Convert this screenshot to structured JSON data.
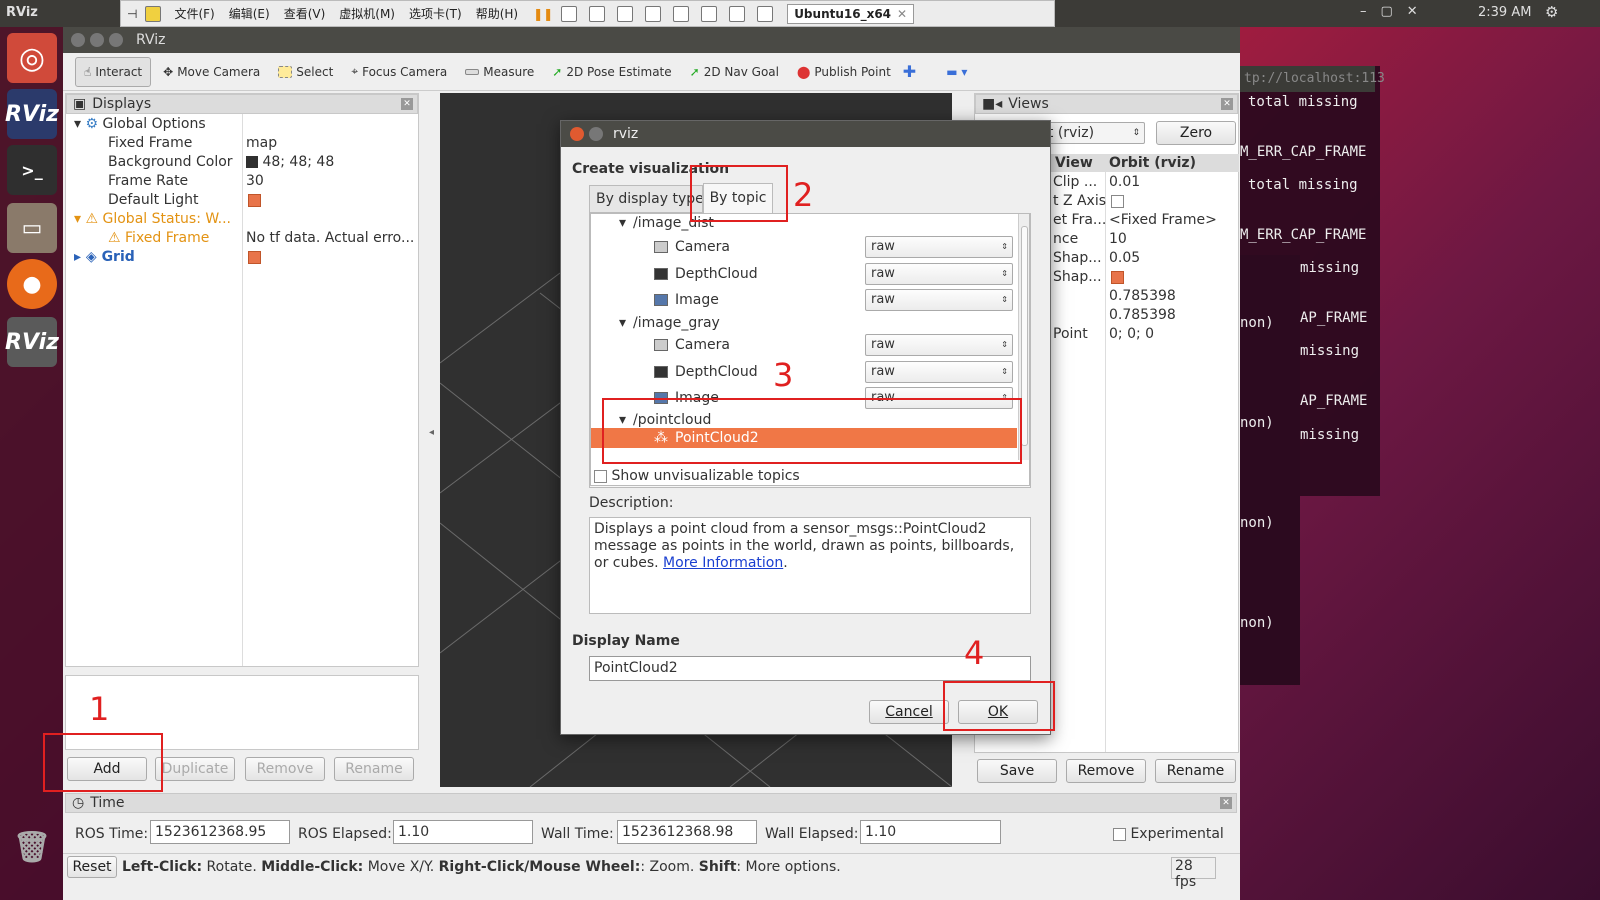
{
  "topbar": {
    "app": "RViz",
    "time": "2:39 AM"
  },
  "vmware": {
    "menus": [
      "文件(F)",
      "编辑(E)",
      "查看(V)",
      "虚拟机(M)",
      "选项卡(T)",
      "帮助(H)"
    ],
    "tab": "Ubuntu16_x64"
  },
  "launcher": {
    "items": [
      "RViz",
      "RViz"
    ]
  },
  "rviz": {
    "title": "RViz",
    "tools": [
      "Interact",
      "Move Camera",
      "Select",
      "Focus Camera",
      "Measure",
      "2D Pose Estimate",
      "2D Nav Goal",
      "Publish Point"
    ],
    "displays": {
      "title": "Displays",
      "rows": [
        {
          "name": "Global Options",
          "value": ""
        },
        {
          "name": "Fixed Frame",
          "value": "map"
        },
        {
          "name": "Background Color",
          "value": "48; 48; 48"
        },
        {
          "name": "Frame Rate",
          "value": "30"
        },
        {
          "name": "Default Light",
          "value": ""
        },
        {
          "name": "Global Status: W...",
          "value": ""
        },
        {
          "name": "Fixed Frame",
          "value": "No tf data.  Actual erro..."
        },
        {
          "name": "Grid",
          "value": ""
        }
      ],
      "buttons": {
        "add": "Add",
        "duplicate": "Duplicate",
        "remove": "Remove",
        "rename": "Rename"
      }
    },
    "views": {
      "title": "Views",
      "type": "it (rviz)",
      "zero": "Zero",
      "col1": "View",
      "col2": "Orbit (rviz)",
      "rows": [
        {
          "k": "Clip ...",
          "v": "0.01"
        },
        {
          "k": "t Z Axis",
          "v": ""
        },
        {
          "k": "et Fra...",
          "v": "<Fixed Frame>"
        },
        {
          "k": "nce",
          "v": "10"
        },
        {
          "k": "Shap...",
          "v": "0.05"
        },
        {
          "k": "Shap...",
          "v": ""
        },
        {
          "k": "",
          "v": "0.785398"
        },
        {
          "k": "",
          "v": "0.785398"
        },
        {
          "k": "Point",
          "v": "0; 0; 0"
        }
      ],
      "buttons": {
        "save": "Save",
        "remove": "Remove",
        "rename": "Rename"
      }
    },
    "time": {
      "title": "Time",
      "ros_time_label": "ROS Time:",
      "ros_time": "1523612368.95",
      "ros_elapsed_label": "ROS Elapsed:",
      "ros_elapsed": "1.10",
      "wall_time_label": "Wall Time:",
      "wall_time": "1523612368.98",
      "wall_elapsed_label": "Wall Elapsed:",
      "wall_elapsed": "1.10",
      "experimental": "Experimental"
    },
    "status": {
      "reset": "Reset",
      "lc": "Left-Click:",
      "lc_t": " Rotate. ",
      "mc": "Middle-Click:",
      "mc_t": " Move X/Y. ",
      "rc": "Right-Click/Mouse Wheel:",
      "rc_t": ": Zoom. ",
      "sh": "Shift",
      "sh_t": ": More options.",
      "fps": "28 fps"
    }
  },
  "terminal": {
    "url": "tp://localhost:113",
    "lines": [
      "total missing",
      "M_ERR_CAP_FRAME",
      "total missing",
      "M_ERR_CAP_FRAME",
      "missing",
      "non)",
      "AP_FRAME",
      "missing",
      "AP_FRAME",
      "non)",
      "missing",
      "non)",
      "non)"
    ]
  },
  "dialog": {
    "title": "rviz",
    "create": "Create visualization",
    "tab1": "By display type",
    "tab2": "By topic",
    "tree": [
      {
        "label": "/image_dist",
        "kind": "topic"
      },
      {
        "label": "Camera",
        "kind": "item",
        "sel": "raw"
      },
      {
        "label": "DepthCloud",
        "kind": "item",
        "sel": "raw"
      },
      {
        "label": "Image",
        "kind": "item",
        "sel": "raw"
      },
      {
        "label": "/image_gray",
        "kind": "topic"
      },
      {
        "label": "Camera",
        "kind": "item",
        "sel": "raw"
      },
      {
        "label": "DepthCloud",
        "kind": "item",
        "sel": "raw"
      },
      {
        "label": "Image",
        "kind": "item",
        "sel": "raw"
      },
      {
        "label": "/pointcloud",
        "kind": "topic"
      },
      {
        "label": "PointCloud2",
        "kind": "selected"
      }
    ],
    "show_unvis": "Show unvisualizable topics",
    "desc_label": "Description:",
    "desc": "Displays a point cloud from a sensor_msgs::PointCloud2 message as points in the world, drawn as points, billboards, or cubes. ",
    "desc_link": "More Information",
    "name_label": "Display Name",
    "name_value": "PointCloud2",
    "cancel": "Cancel",
    "ok": "OK"
  },
  "annotations": [
    "1",
    "2",
    "3",
    "4"
  ],
  "colors": {
    "accent": "#f07746",
    "red": "#e02020",
    "view_bg": "#303030"
  }
}
